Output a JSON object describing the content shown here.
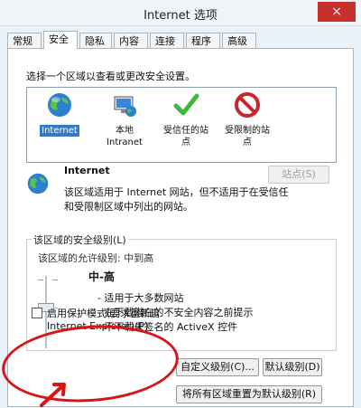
{
  "window": {
    "title": "Internet 选项",
    "close": "×"
  },
  "tabs": [
    "常规",
    "安全",
    "隐私",
    "内容",
    "连接",
    "程序",
    "高级"
  ],
  "security": {
    "zone_prompt": "选择一个区域以查看或更改安全设置。",
    "zones": [
      {
        "line1": "Internet",
        "line2": ""
      },
      {
        "line1": "本地",
        "line2": "Intranet"
      },
      {
        "line1": "受信任的站",
        "line2": "点"
      },
      {
        "line1": "受限制的站",
        "line2": "点"
      }
    ],
    "zone_heading": "Internet",
    "zone_desc_1": "该区域适用于 Internet 网站，但不适用于在受信任",
    "zone_desc_2": "和受限制区域中列出的网站。",
    "sites_button": "站点(S)",
    "level_group_title": "该区域的安全级别(L)",
    "allowed_levels": "该区域的允许级别: 中到高",
    "level_name": "中-高",
    "bullets": [
      "- 适用于大多数网站",
      "- 在下载潜在的不安全内容之前提示",
      "- 不下载未签名的 ActiveX 控件"
    ],
    "protected_mode_line1": "启用保护模式(要求重新启",
    "protected_mode_line2": "Internet Explorer)(P)",
    "custom_level_button": "自定义级别(C)...",
    "default_level_button": "默认级别(D)",
    "reset_all_button": "将所有区域重置为默认级别(R)"
  }
}
